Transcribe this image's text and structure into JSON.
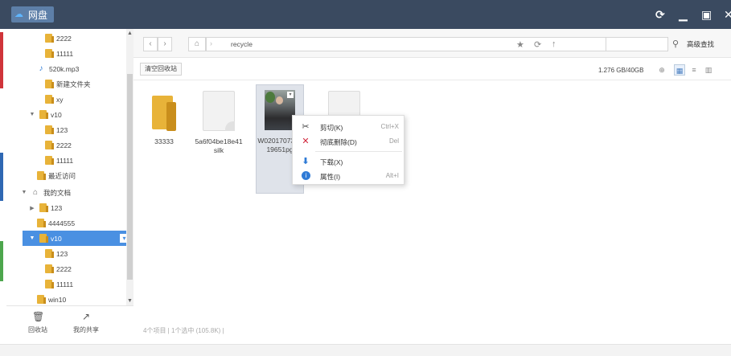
{
  "app": {
    "title": "网盘",
    "accent": "#4a90e2",
    "titlebar_color": "#3a4a60",
    "controls": [
      "refresh-icon",
      "minimize-icon",
      "maximize-icon",
      "close-icon"
    ]
  },
  "sidebar": {
    "items": [
      {
        "label": "2222",
        "type": "folder",
        "expanded": null
      },
      {
        "label": "11111",
        "type": "folder",
        "expanded": null
      },
      {
        "label": "520k.mp3",
        "type": "music",
        "expanded": null
      },
      {
        "label": "新建文件夹",
        "type": "folder",
        "expanded": null
      },
      {
        "label": "xy",
        "type": "folder",
        "expanded": null
      },
      {
        "label": "v10",
        "type": "folder",
        "expanded": true
      },
      {
        "label": "123",
        "type": "folder",
        "expanded": null
      },
      {
        "label": "2222",
        "type": "folder",
        "expanded": null
      },
      {
        "label": "11111",
        "type": "folder",
        "expanded": null
      },
      {
        "label": "最近访问",
        "type": "folder",
        "expanded": null
      },
      {
        "label": "我的文档",
        "type": "home",
        "expanded": true
      },
      {
        "label": "123",
        "type": "folder",
        "expanded": false
      },
      {
        "label": "4444555",
        "type": "folder",
        "expanded": null
      },
      {
        "label": "v10",
        "type": "folder",
        "expanded": true,
        "selected": true
      },
      {
        "label": "123",
        "type": "folder",
        "expanded": null
      },
      {
        "label": "2222",
        "type": "folder",
        "expanded": null
      },
      {
        "label": "11111",
        "type": "folder",
        "expanded": null
      },
      {
        "label": "win10",
        "type": "folder",
        "expanded": null
      }
    ],
    "bottom": {
      "recycle_label": "回收站",
      "share_label": "我的共享"
    }
  },
  "nav": {
    "path": "recycle",
    "advanced_search": "高级查找"
  },
  "toolbar": {
    "empty_recycle": "清空回收站",
    "quota": "1.276 GB/40GB"
  },
  "files": [
    {
      "name": "33333",
      "type": "folder"
    },
    {
      "name": "5a6f04be18e41silk",
      "type": "doc"
    },
    {
      "name": "W020170734819651pg",
      "type": "image",
      "selected": true
    },
    {
      "name": "",
      "type": "doc"
    }
  ],
  "context_menu": {
    "items": [
      {
        "label": "剪切(K)",
        "shortcut": "Ctrl+X",
        "icon": "scissors-icon"
      },
      {
        "label": "彻底删除(D)",
        "shortcut": "Del",
        "icon": "delete-x-icon"
      },
      {
        "label": "下载(X)",
        "shortcut": "",
        "icon": "download-icon"
      },
      {
        "label": "属性(I)",
        "shortcut": "Alt+I",
        "icon": "info-icon"
      }
    ]
  },
  "status": {
    "text": "4个项目 | 1个选中 (105.8K) |"
  }
}
